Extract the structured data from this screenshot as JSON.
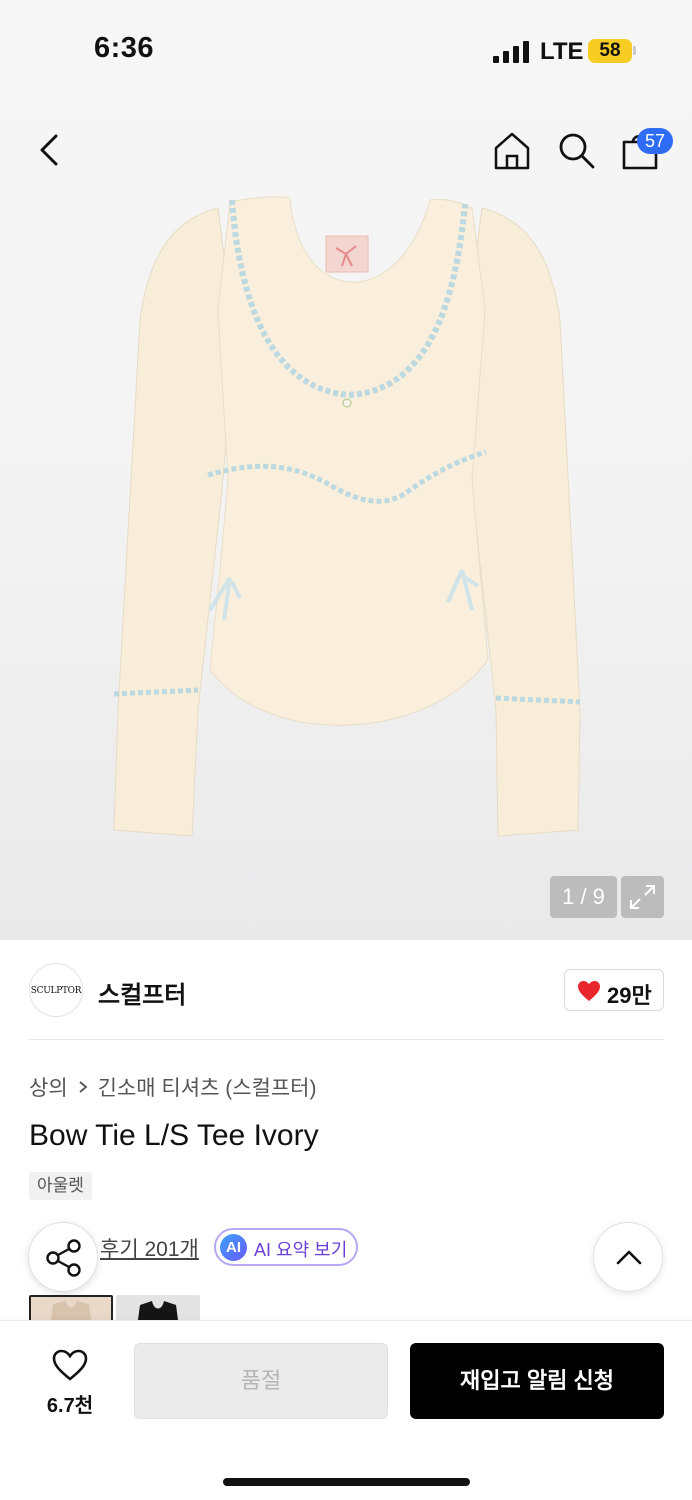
{
  "status_bar": {
    "time": "6:36",
    "network": "LTE",
    "battery": "58"
  },
  "header": {
    "cart_count": "57"
  },
  "gallery": {
    "counter": "1 / 9"
  },
  "brand": {
    "logo_text": "SCULPTOR",
    "name": "스컬프터",
    "likes": "29만"
  },
  "breadcrumb": {
    "level1": "상의",
    "level2": "긴소매 티셔츠 (스컬프터)"
  },
  "product": {
    "title": "Bow Tie L/S Tee Ivory",
    "tag": "아울렛"
  },
  "review": {
    "label": "후기 201개",
    "ai_badge": "AI",
    "ai_label": "AI 요약 보기"
  },
  "bottom_bar": {
    "wish_count": "6.7천",
    "soldout_label": "품절",
    "restock_label": "재입고 알림 신청"
  },
  "colors": {
    "accent": "#2f6cf5",
    "heart": "#e8262b",
    "ai_border": "#b9a6f3",
    "battery": "#f7cd24"
  }
}
